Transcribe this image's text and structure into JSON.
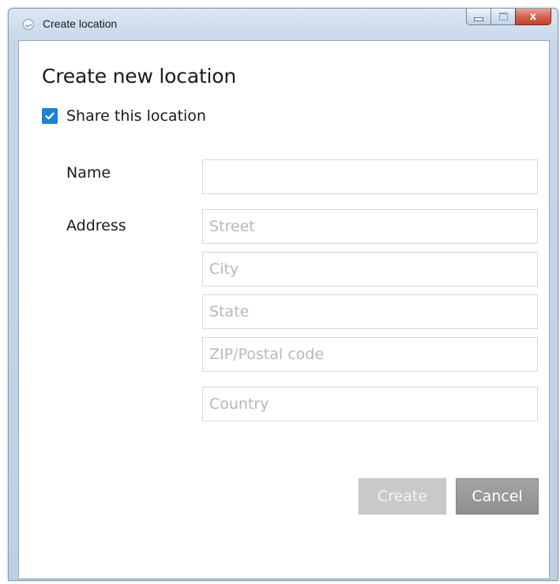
{
  "window": {
    "title": "Create location",
    "close_glyph": "x"
  },
  "dialog": {
    "heading": "Create new location",
    "share": {
      "label": "Share this location",
      "checked": true
    },
    "name": {
      "label": "Name",
      "value": "",
      "placeholder": ""
    },
    "address": {
      "label": "Address",
      "street_placeholder": "Street",
      "city_placeholder": "City",
      "state_placeholder": "State",
      "zip_placeholder": "ZIP/Postal code",
      "country_placeholder": "Country"
    },
    "buttons": {
      "create_label": "Create",
      "cancel_label": "Cancel"
    }
  },
  "icons": {
    "window": "app-icon",
    "checkbox": "checkmark-icon",
    "minimize": "minimize-icon",
    "maximize": "maximize-icon",
    "close": "close-icon"
  },
  "colors": {
    "accent": "#1f7fd1",
    "close_button": "#d5634f",
    "disabled_button": "#c9c9c9",
    "cancel_button": "#9a9a9a"
  }
}
